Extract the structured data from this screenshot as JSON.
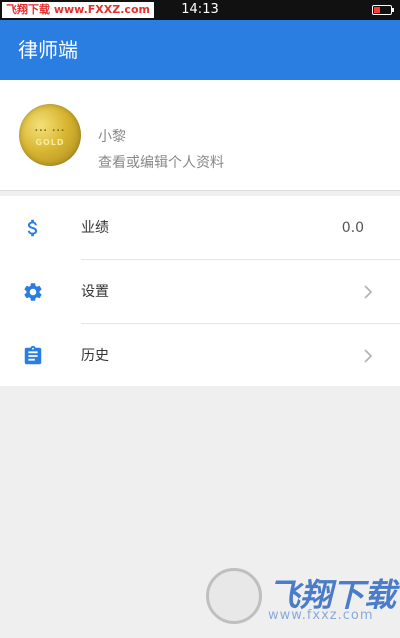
{
  "status_bar": {
    "watermark": "飞翔下载 www.FXXZ.com",
    "time": "14:13"
  },
  "app_bar": {
    "title": "律师端"
  },
  "profile": {
    "avatar_text": [
      "... ...",
      "GOLD"
    ],
    "name": "小黎",
    "subtitle": "查看或编辑个人资料"
  },
  "menu": {
    "items": [
      {
        "label": "业绩",
        "value": "0.0",
        "icon": "dollar-icon"
      },
      {
        "label": "设置",
        "icon": "gear-icon"
      },
      {
        "label": "历史",
        "icon": "clipboard-icon"
      }
    ]
  },
  "watermark": {
    "title": "飞翔下载",
    "url": "www.fxxz.com"
  },
  "colors": {
    "primary": "#2a7de1",
    "icon": "#2a7de1"
  }
}
